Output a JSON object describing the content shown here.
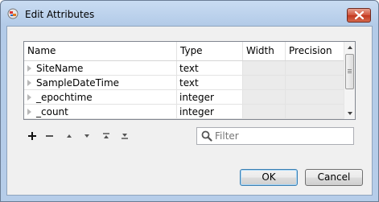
{
  "window": {
    "title": "Edit Attributes"
  },
  "grid": {
    "columns": [
      "Name",
      "Type",
      "Width",
      "Precision"
    ],
    "rows": [
      {
        "name": "SiteName",
        "type": "text",
        "width": "",
        "precision": ""
      },
      {
        "name": "SampleDateTime",
        "type": "text",
        "width": "",
        "precision": ""
      },
      {
        "name": "_epochtime",
        "type": "integer",
        "width": "",
        "precision": ""
      },
      {
        "name": "_count",
        "type": "integer",
        "width": "",
        "precision": ""
      }
    ]
  },
  "toolbar": {
    "icons": [
      "add-icon",
      "remove-icon",
      "move-up-icon",
      "move-down-icon",
      "move-to-top-icon",
      "move-to-bottom-icon"
    ]
  },
  "filter": {
    "placeholder": "Filter",
    "value": ""
  },
  "buttons": {
    "ok": "OK",
    "cancel": "Cancel"
  },
  "colors": {
    "title_bg": "#c4d8f0",
    "client_bg": "#f0f0f0",
    "gray_cell": "#ebebeb",
    "close_red": "#c2371f"
  }
}
